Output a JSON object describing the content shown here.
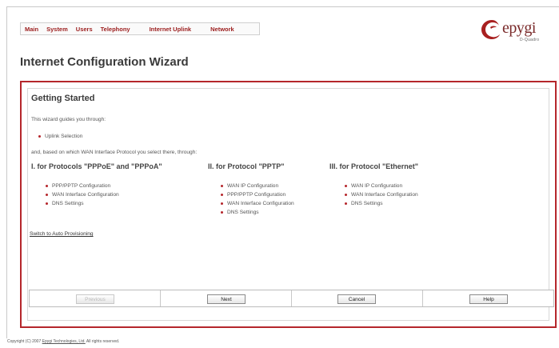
{
  "menu": {
    "items": [
      "Main",
      "System",
      "Users",
      "Telephony",
      "Internet Uplink",
      "Network"
    ]
  },
  "logo": {
    "word": "epygi",
    "sub": "D-Quadro"
  },
  "page": {
    "title": "Internet Configuration Wizard"
  },
  "panel": {
    "heading": "Getting Started",
    "intro": "This wizard guides you through:",
    "intro_bullets": [
      "Uplink Selection"
    ],
    "based_on": "and, based on which WAN Interface Protocol you select there, through:",
    "columns": [
      {
        "heading": "I. for Protocols \"PPPoE\" and \"PPPoA\"",
        "items": [
          "PPP/PPTP Configuration",
          "WAN Interface Configuration",
          "DNS Settings"
        ]
      },
      {
        "heading": "II. for Protocol \"PPTP\"",
        "items": [
          "WAN IP Configuration",
          "PPP/PPTP Configuration",
          "WAN Interface Configuration",
          "DNS Settings"
        ]
      },
      {
        "heading": "III. for Protocol \"Ethernet\"",
        "items": [
          "WAN IP Configuration",
          "WAN Interface Configuration",
          "DNS Settings"
        ]
      }
    ],
    "switch_link": "Switch to Auto Provisioning"
  },
  "buttons": {
    "previous": "Previous",
    "next": "Next",
    "cancel": "Cancel",
    "help": "Help"
  },
  "footer": {
    "prefix": "Copyright (C) 2007",
    "company": "Epygi Technologies, Ltd.",
    "suffix": "All rights reserved."
  },
  "colors": {
    "accent": "#b5262b",
    "menu_text": "#9b1c1c"
  }
}
